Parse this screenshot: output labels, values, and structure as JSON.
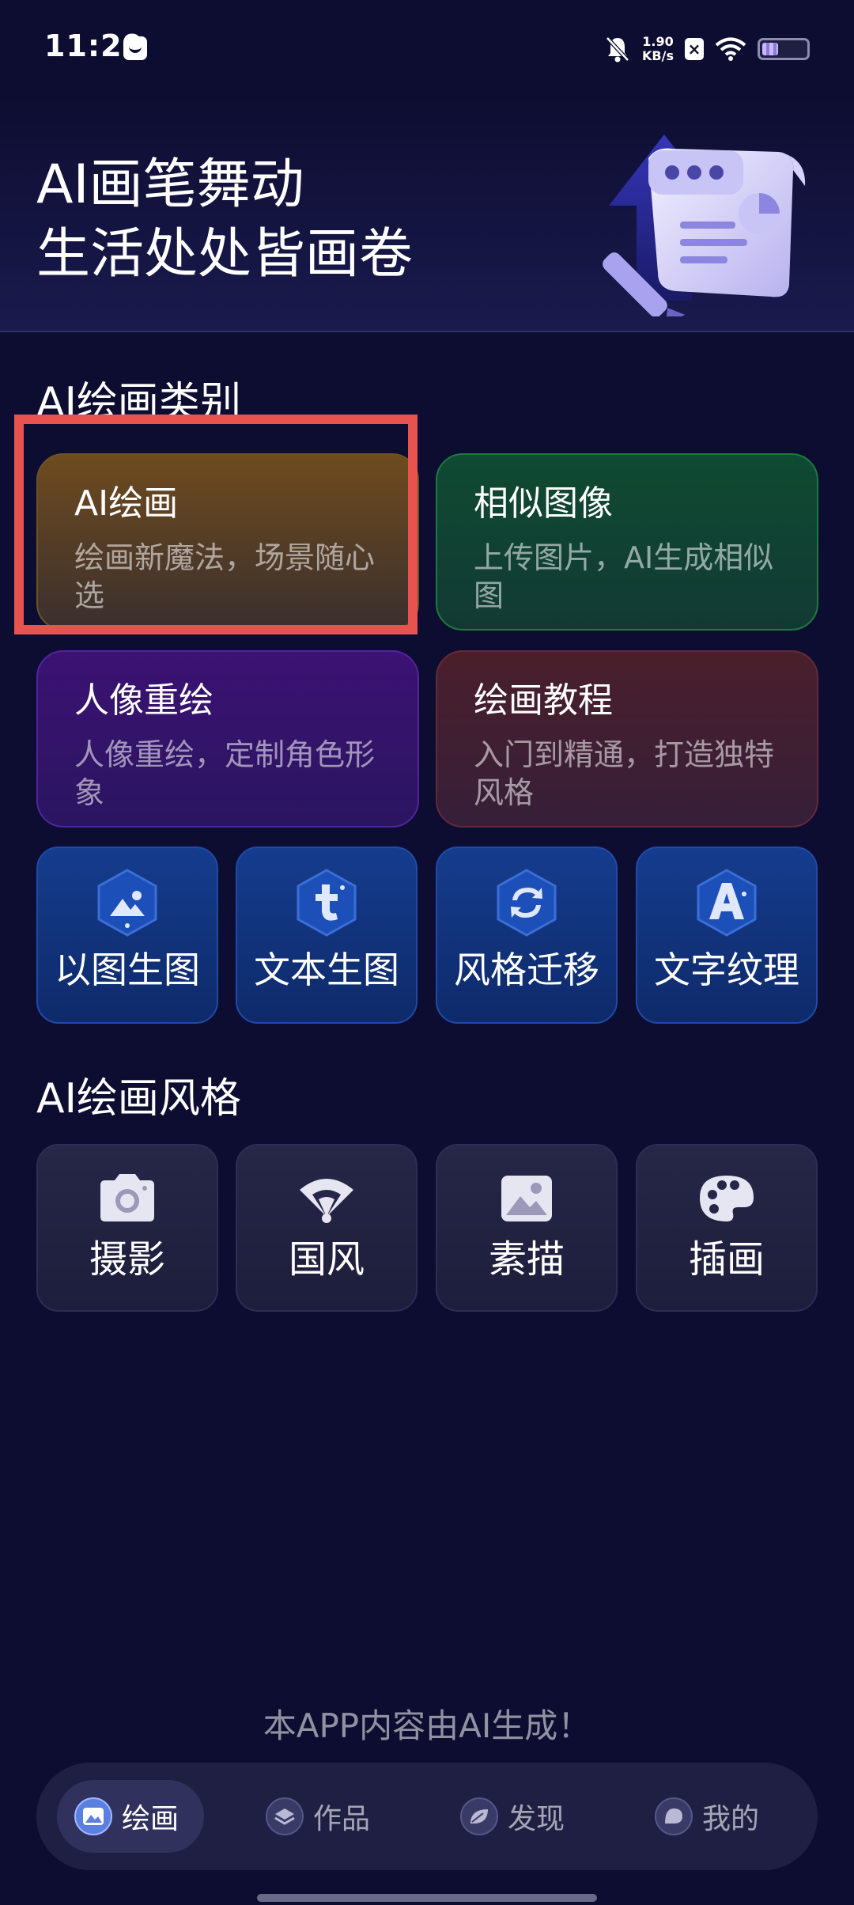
{
  "status_bar": {
    "time": "11:29",
    "net_speed_value": "1.90",
    "net_speed_unit": "KB/s",
    "icons": [
      "message-icon",
      "bell-muted-icon",
      "close-badge-icon",
      "wifi-icon",
      "battery-icon"
    ],
    "battery_level": 0.34
  },
  "hero": {
    "title_line1": "AI画笔舞动",
    "title_line2": "生活处处皆画卷"
  },
  "categories_section": {
    "title": "AI绘画类别",
    "cards": [
      {
        "title": "AI绘画",
        "desc": "绘画新魔法，场景随心选"
      },
      {
        "title": "相似图像",
        "desc": "上传图片，AI生成相似图"
      },
      {
        "title": "人像重绘",
        "desc": "人像重绘，定制角色形象"
      },
      {
        "title": "绘画教程",
        "desc": "入门到精通，打造独特风格"
      }
    ],
    "tools": [
      {
        "label": "以图生图",
        "icon": "image-to-image-icon"
      },
      {
        "label": "文本生图",
        "icon": "text-to-image-icon"
      },
      {
        "label": "风格迁移",
        "icon": "style-transfer-icon"
      },
      {
        "label": "文字纹理",
        "icon": "text-texture-icon"
      }
    ]
  },
  "styles_section": {
    "title": "AI绘画风格",
    "items": [
      {
        "label": "摄影",
        "icon": "camera-icon"
      },
      {
        "label": "国风",
        "icon": "folding-fan-icon"
      },
      {
        "label": "素描",
        "icon": "picture-icon"
      },
      {
        "label": "插画",
        "icon": "palette-icon"
      }
    ]
  },
  "footer_note": "本APP内容由AI生成！",
  "bottom_nav": {
    "active": "绘画",
    "items": [
      {
        "label": "绘画",
        "icon": "painting-icon"
      },
      {
        "label": "作品",
        "icon": "layers-icon"
      },
      {
        "label": "发现",
        "icon": "leaf-icon"
      },
      {
        "label": "我的",
        "icon": "profile-icon"
      }
    ]
  },
  "colors": {
    "background": "#0d0d31",
    "highlight": "#e8524f",
    "tool_tile": "#153c8d"
  }
}
